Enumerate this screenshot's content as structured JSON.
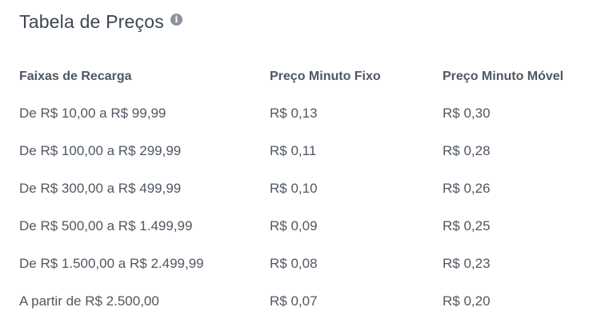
{
  "header": {
    "title": "Tabela de Preços",
    "info_icon": "info-icon"
  },
  "table": {
    "columns": [
      "Faixas de Recarga",
      "Preço Minuto Fixo",
      "Preço Minuto Móvel"
    ],
    "rows": [
      [
        "De R$ 10,00 a R$ 99,99",
        "R$ 0,13",
        "R$ 0,30"
      ],
      [
        "De R$ 100,00 a R$ 299,99",
        "R$ 0,11",
        "R$ 0,28"
      ],
      [
        "De R$ 300,00 a R$ 499,99",
        "R$ 0,10",
        "R$ 0,26"
      ],
      [
        "De R$ 500,00 a R$ 1.499,99",
        "R$ 0,09",
        "R$ 0,25"
      ],
      [
        "De R$ 1.500,00 a R$ 2.499,99",
        "R$ 0,08",
        "R$ 0,23"
      ],
      [
        "A partir de R$ 2.500,00",
        "R$ 0,07",
        "R$ 0,20"
      ]
    ]
  },
  "colors": {
    "text": "#4f5862",
    "title": "#3d4650",
    "icon": "#8a939c",
    "background": "#ffffff"
  }
}
